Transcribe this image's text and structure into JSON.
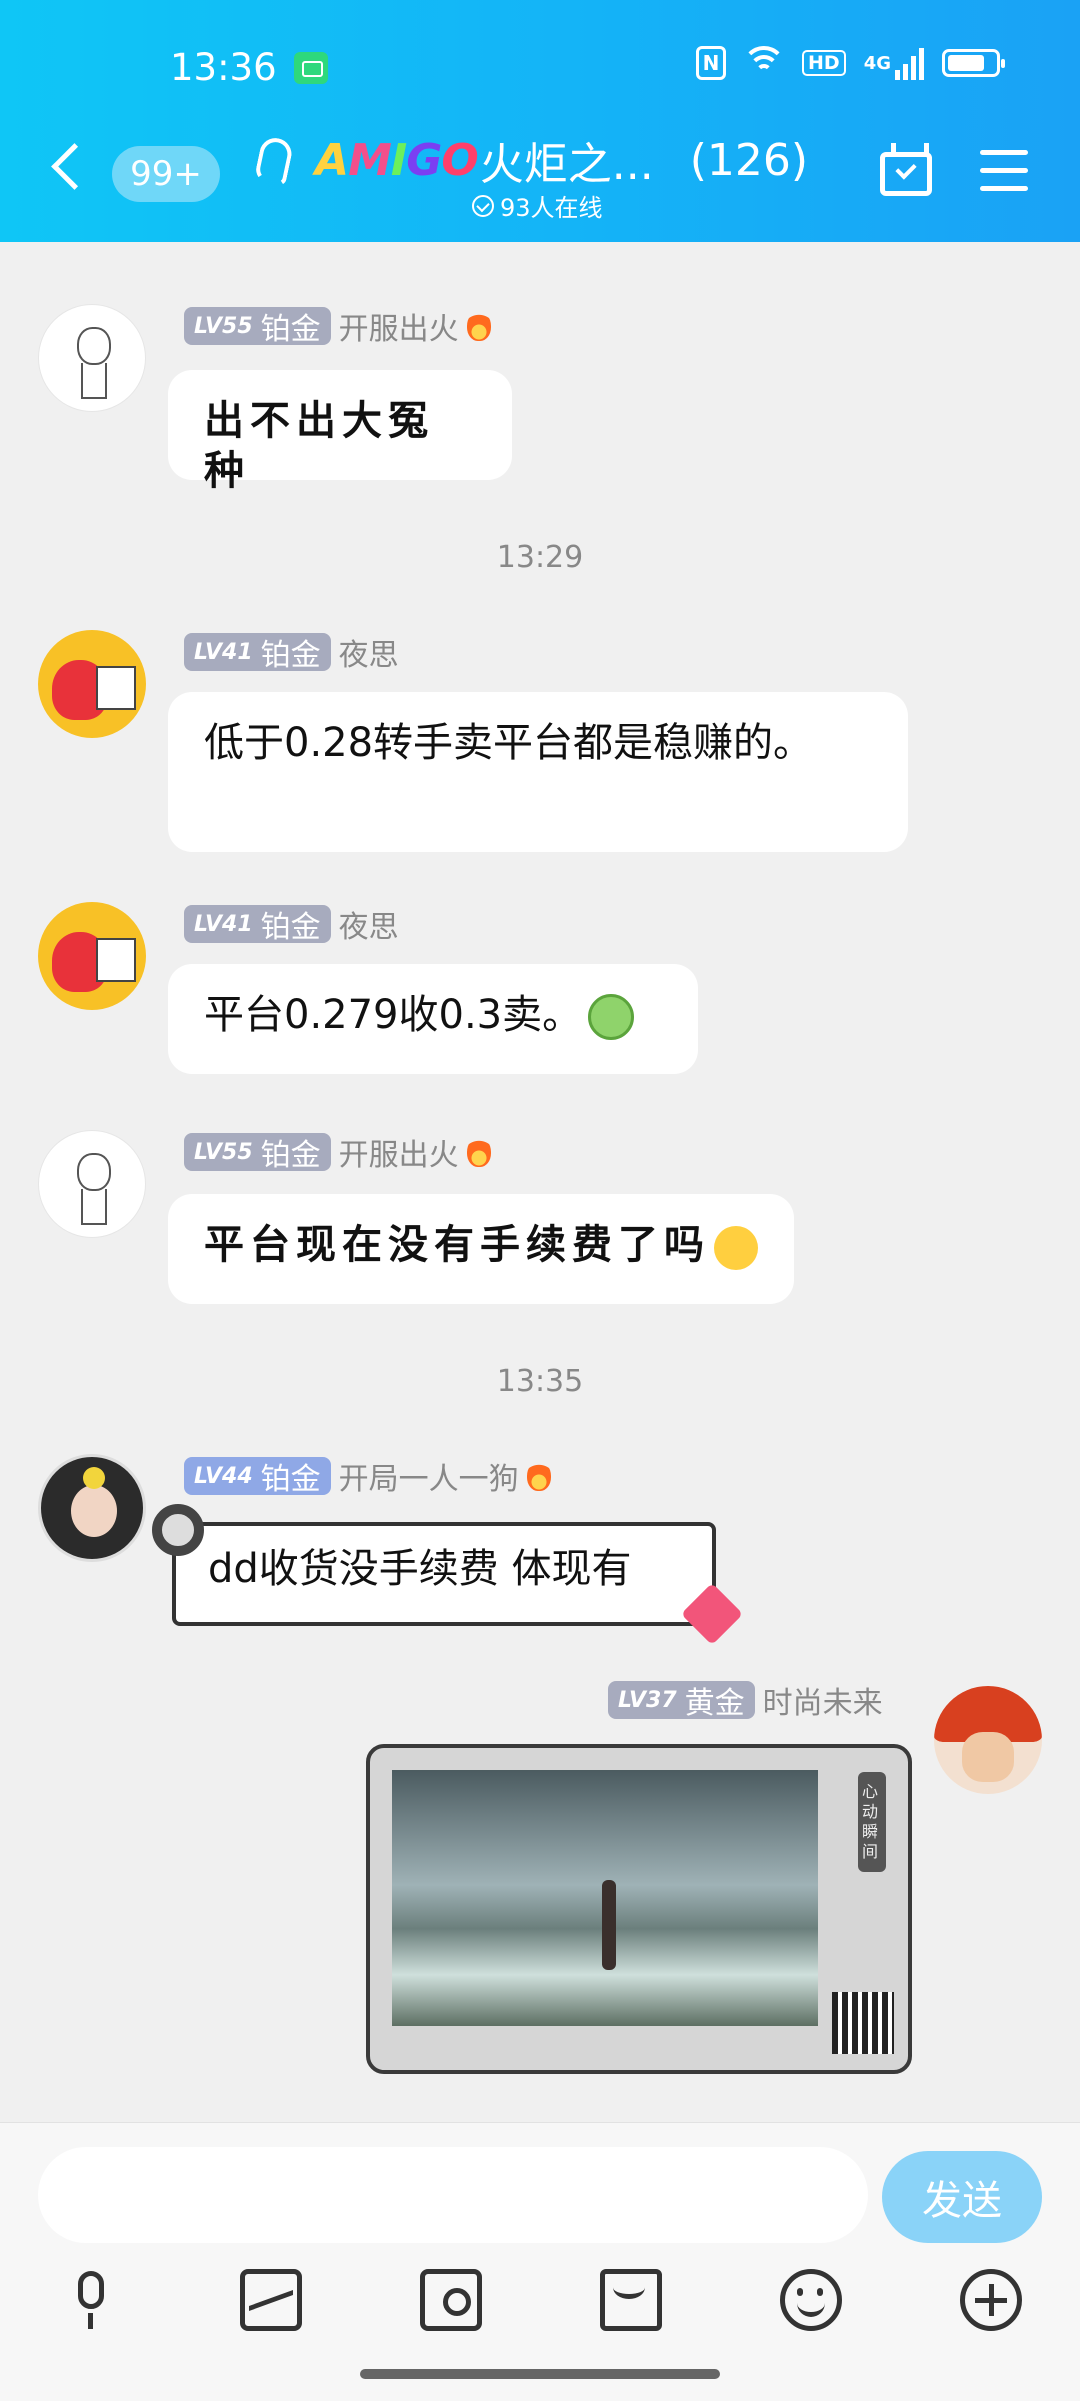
{
  "status_bar": {
    "time": "13:36",
    "network": "4G",
    "hd": "HD",
    "nfc": "N"
  },
  "header": {
    "unread": "99+",
    "logo": [
      "A",
      "M",
      "I",
      "G",
      "O"
    ],
    "title": "火炬之...",
    "member_count": "(126)",
    "online": "93人在线"
  },
  "chat": {
    "clipped_text": "",
    "messages": [
      {
        "level": "LV55",
        "title": "铂金",
        "name": "开服出火",
        "text": "出不出大冤种"
      },
      {
        "level": "LV41",
        "title": "铂金",
        "name": "夜思",
        "text": "低于0.28转手卖平台都是稳赚的。"
      },
      {
        "level": "LV41",
        "title": "铂金",
        "name": "夜思",
        "text": "平台0.279收0.3卖。"
      },
      {
        "level": "LV55",
        "title": "铂金",
        "name": "开服出火",
        "text": "平台现在没有手续费了吗"
      },
      {
        "level": "LV44",
        "title": "铂金",
        "name": "开局一人一狗",
        "text": "dd收货没手续费 体现有"
      },
      {
        "level": "LV37",
        "title": "黄金",
        "name": "时尚未来",
        "image_text": "心动瞬间"
      }
    ],
    "timestamps": [
      "13:29",
      "13:35"
    ]
  },
  "input": {
    "placeholder": "",
    "send_label": "发送"
  }
}
